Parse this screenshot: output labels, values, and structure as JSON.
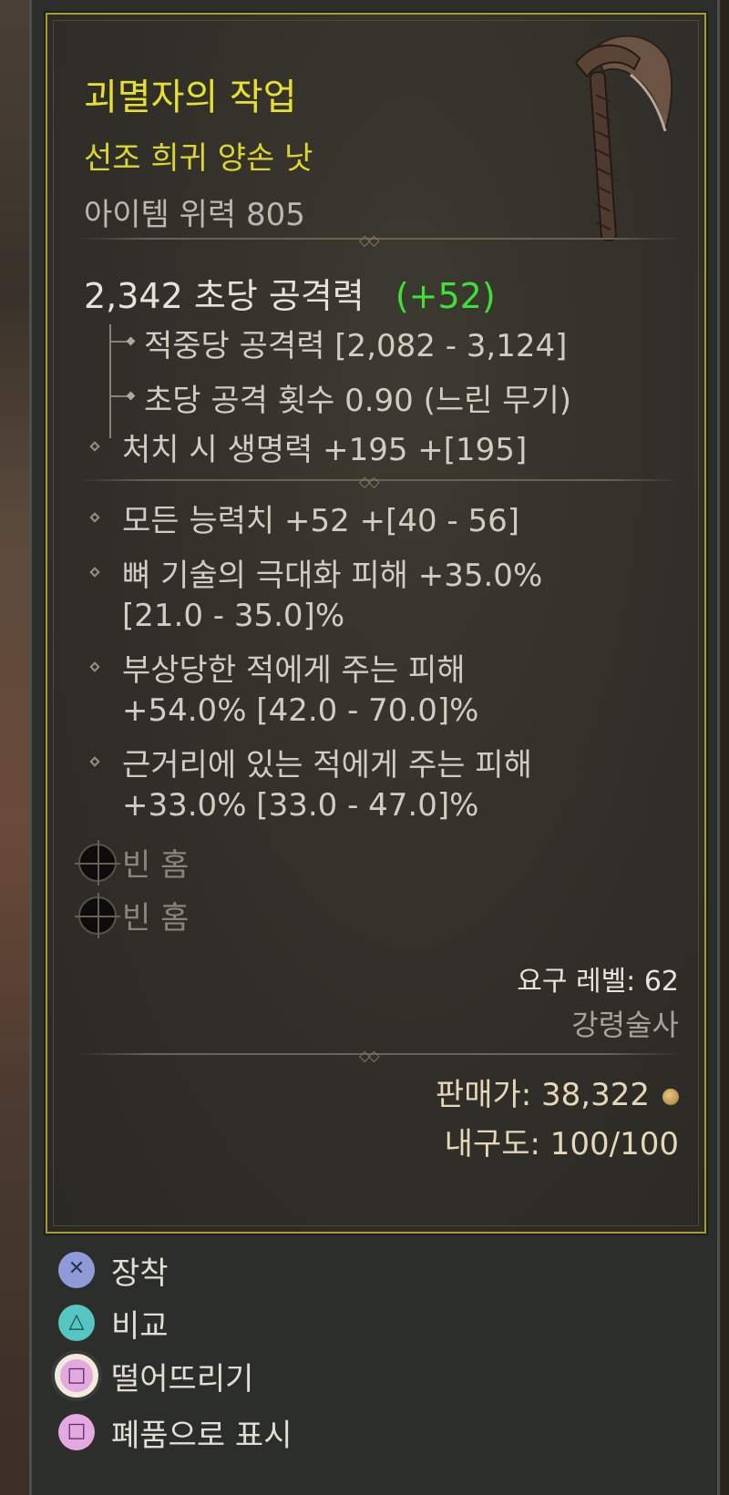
{
  "item": {
    "name": "괴멸자의 작업",
    "rarity_type": "선조 희귀 양손 낫",
    "item_power": "아이템 위력 805",
    "dps_value": "2,342 초당 공격력",
    "dps_delta": "(+52)",
    "damage_per_hit": "적중당 공격력 [2,082 - 3,124]",
    "attacks_per_second": "초당 공격 횟수 0.90 (느린 무기)",
    "implicit": "처치 시 생명력 +195 +[195]",
    "affixes": [
      {
        "line1": "모든 능력치 +52 +[40 - 56]",
        "line2": ""
      },
      {
        "line1": "뼈 기술의 극대화 피해 +35.0%",
        "line2": "[21.0 - 35.0]%"
      },
      {
        "line1": "부상당한 적에게 주는 피해",
        "line2": "+54.0% [42.0 - 70.0]%"
      },
      {
        "line1": "근거리에 있는 적에게 주는 피해",
        "line2": "+33.0% [33.0 - 47.0]%"
      }
    ],
    "sockets": [
      "빈 홈",
      "빈 홈"
    ],
    "required_level": "요구 레벨: 62",
    "class": "강령술사",
    "sell_value": "판매가: 38,322",
    "durability": "내구도: 100/100",
    "icon": "scythe-icon"
  },
  "actions": [
    {
      "label": "장착",
      "button": "cross",
      "glyph": "✕"
    },
    {
      "label": "비교",
      "button": "triangle",
      "glyph": "△"
    },
    {
      "label": "떨어뜨리기",
      "button": "square-hold",
      "glyph": "□"
    },
    {
      "label": "폐품으로 표시",
      "button": "square",
      "glyph": "□"
    }
  ],
  "colors": {
    "title": "#e8e031",
    "border": "#a89b2e",
    "positive_delta": "#3fe03a"
  }
}
